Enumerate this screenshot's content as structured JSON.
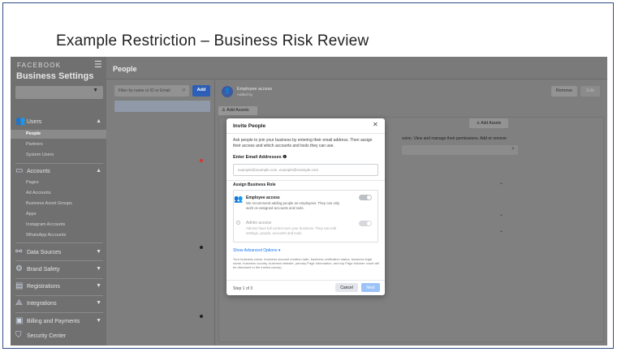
{
  "slide": {
    "title": "Example Restriction – Business Risk Review"
  },
  "sidebar": {
    "brand": "FACEBOOK",
    "title": "Business Settings",
    "sections": [
      {
        "label": "Users",
        "icon": "users-icon",
        "items": [
          "People",
          "Partners",
          "System Users"
        ],
        "active": "People"
      },
      {
        "label": "Accounts",
        "icon": "accounts-icon",
        "items": [
          "Pages",
          "Ad Accounts",
          "Business Asset Groups",
          "Apps",
          "Instagram Accounts",
          "WhatsApp Accounts"
        ]
      },
      {
        "label": "Data Sources",
        "icon": "data-sources-icon"
      },
      {
        "label": "Brand Safety",
        "icon": "brand-safety-icon"
      },
      {
        "label": "Registrations",
        "icon": "registrations-icon"
      },
      {
        "label": "Integrations",
        "icon": "integrations-icon"
      },
      {
        "label": "Billing and Payments",
        "icon": "billing-icon"
      },
      {
        "label": "Security Center",
        "icon": "security-center-icon"
      }
    ]
  },
  "people": {
    "page_title": "People",
    "filter_placeholder": "Filter by name or ID or Email",
    "add_label": "Add"
  },
  "detail": {
    "person_label": "Employee access",
    "added_by": "Added by",
    "remove_label": "Remove",
    "edit_label": "Edit",
    "add_assets_tab": "Add Assets",
    "add_assets_button": "Add Assets",
    "partial_text": "ssion. View and manage their permissions. Add or remove"
  },
  "modal": {
    "title": "Invite People",
    "description": "Ask people to join your business by entering their email address. Then assign their access and which accounts and tools they can use.",
    "email_label": "Enter Email Addresses",
    "email_placeholder": "example@example.com, example@example.com",
    "role_label": "Assign Business Role",
    "roles": [
      {
        "title": "Employee access",
        "desc": "We recommend adding people as employees. They can only work on assigned accounts and tools."
      },
      {
        "title": "Admin access",
        "desc": "Admins have full control over your business. They can edit settings, people, accounts and tools."
      }
    ],
    "advanced_link": "Show Advanced Options",
    "privacy_text": "Your business name, business account creation date, business verification status, business legal name, business country, business website, primary Page information, and top Page follower count will be disclosed to the invited user(s).",
    "step": "Step 1 of 3",
    "cancel_label": "Cancel",
    "next_label": "Next"
  }
}
